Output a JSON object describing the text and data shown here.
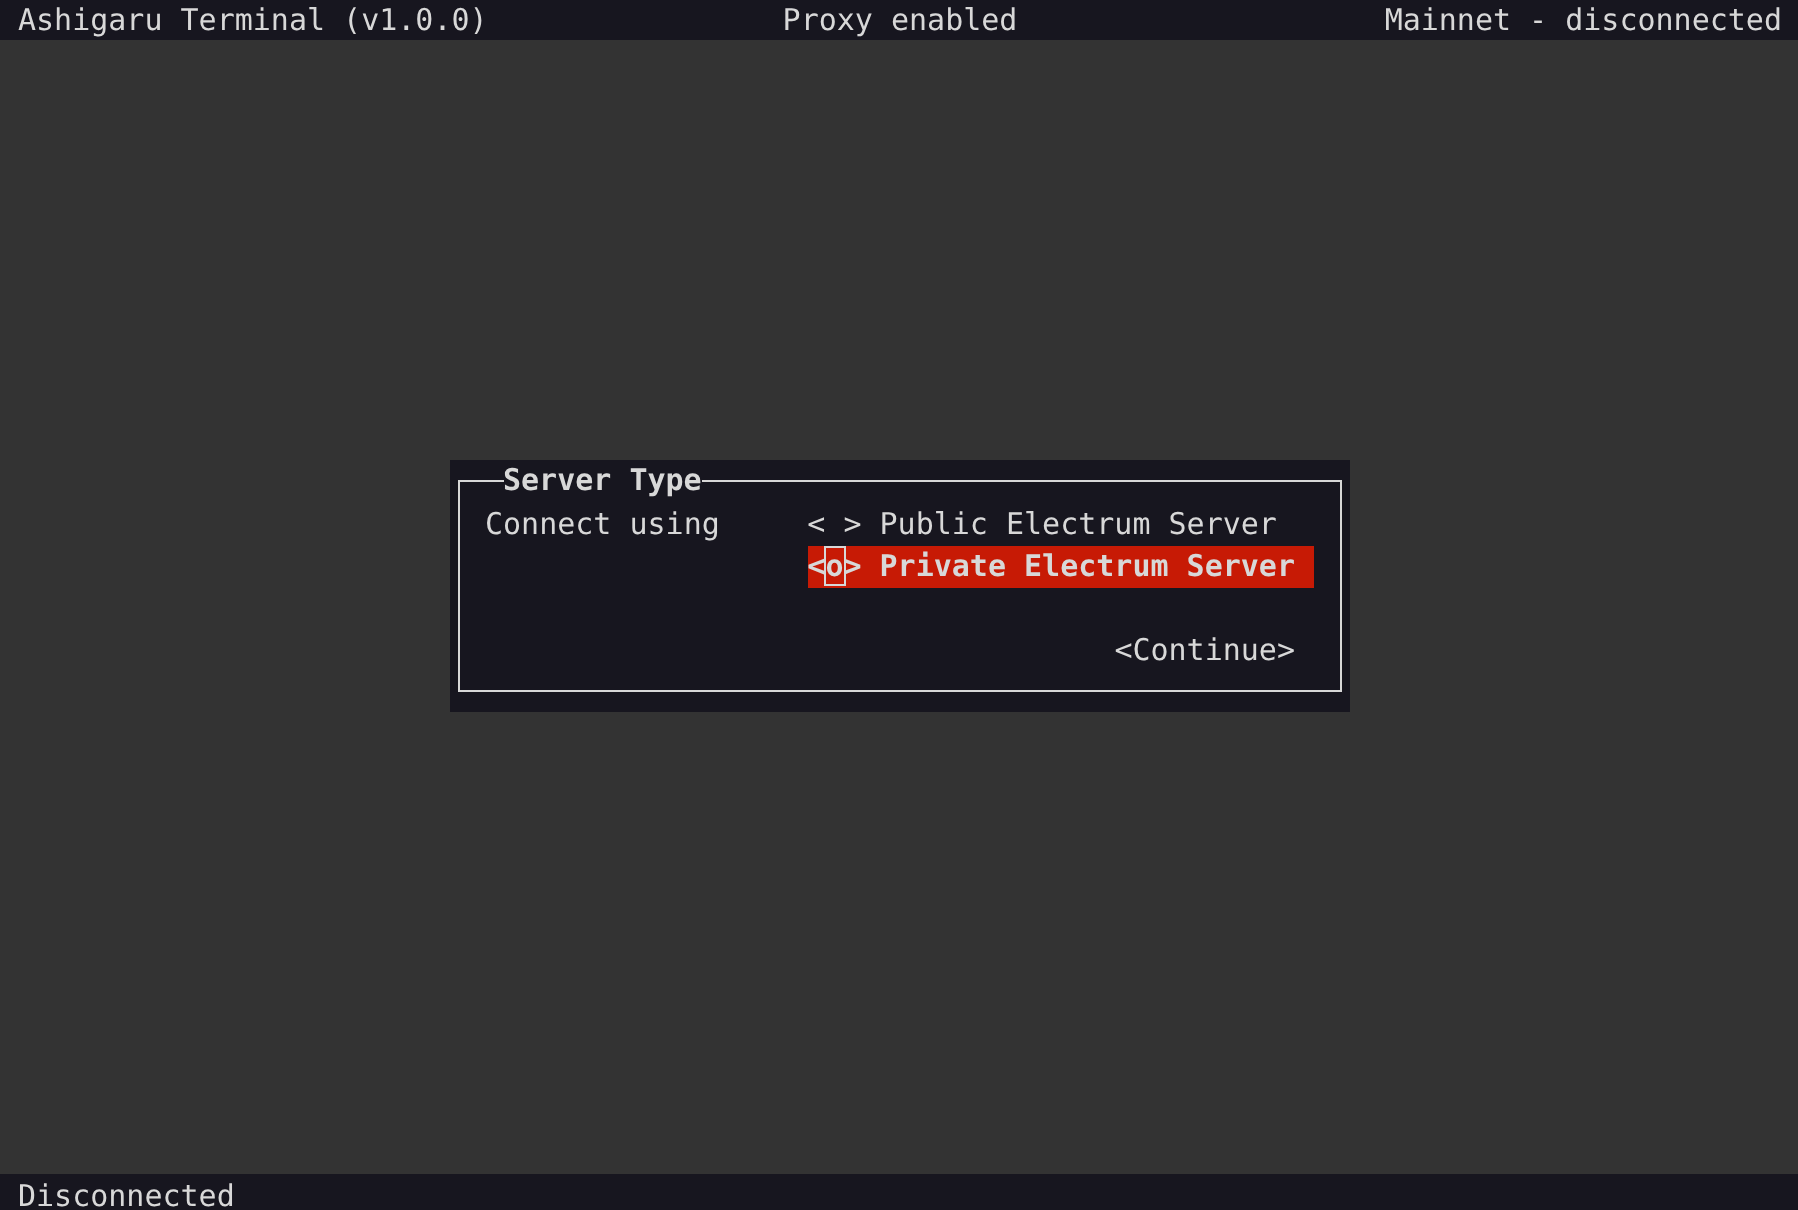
{
  "top_bar": {
    "title": "Ashigaru Terminal (v1.0.0)",
    "proxy": "Proxy enabled",
    "network": "Mainnet - disconnected"
  },
  "dialog": {
    "title": "Server Type",
    "label": "Connect using",
    "options": [
      {
        "marker": "< >",
        "label": "Public Electrum Server",
        "selected": false
      },
      {
        "marker": "<o>",
        "label": "Private Electrum Server",
        "selected": true
      }
    ],
    "button": "<Continue>"
  },
  "status_bar": "Disconnected"
}
